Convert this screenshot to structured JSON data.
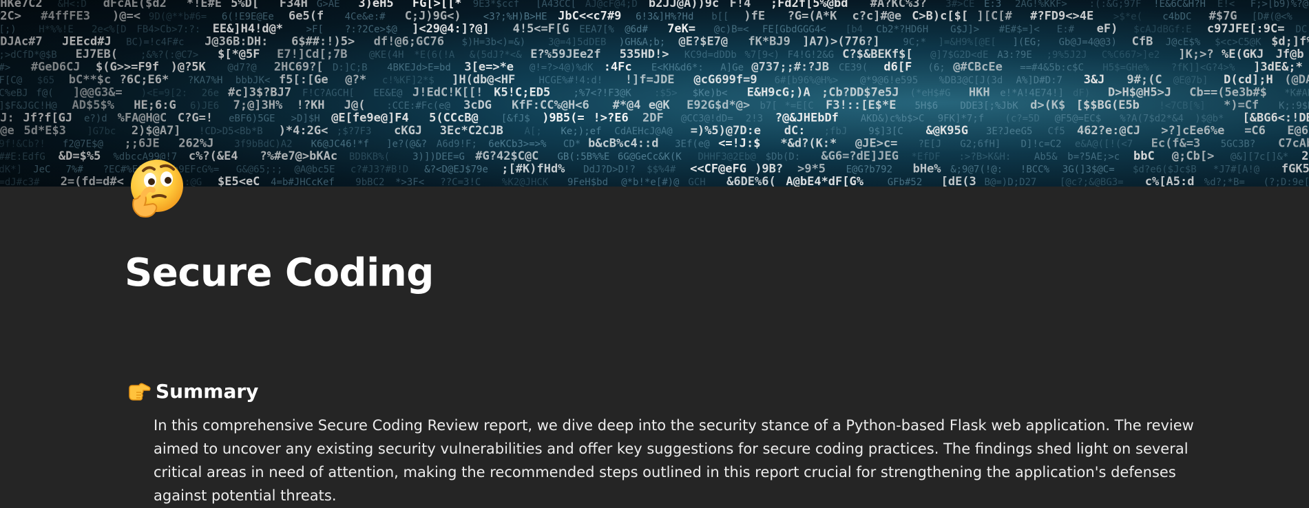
{
  "page": {
    "icon": "thinking-face-emoji",
    "title": "Secure Coding",
    "cover": {
      "description_icon": "matrix-code-cover",
      "colors": {
        "background_dark": "#061a26",
        "glow": "#2a6e86",
        "text_bright": "#ffffff",
        "text_dim": "#7fb2c8"
      }
    }
  },
  "sections": {
    "summary": {
      "icon": "backhand-index-pointing-right-emoji",
      "heading": "Summary",
      "body": "In this comprehensive Secure Coding Review report, we dive deep into the security stance of a Python-based Flask web application. The review aimed to uncover any existing security vulnerabilities and offer key suggestions for secure coding practices. The findings shed light on several critical areas in need of attention, making the recommended steps outlined in this report crucial for strengthening the application's defenses against potential threats."
    }
  },
  "theme": {
    "page_background": "#252525",
    "text": "#ffffff"
  }
}
